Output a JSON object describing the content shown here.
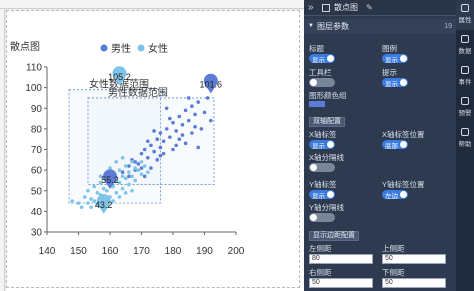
{
  "chart": {
    "title": "散点图",
    "legend": [
      {
        "name": "男性",
        "color": "#5b7bd5"
      },
      {
        "name": "女性",
        "color": "#7ec3ea"
      }
    ],
    "region_labels": [
      "女性数据范围",
      "男性数据范围"
    ],
    "markers": [
      "105.2",
      "101.6",
      "55.2",
      "43.2"
    ]
  },
  "chart_data": {
    "type": "scatter",
    "title": "散点图",
    "xlim": [
      140,
      200
    ],
    "ylim": [
      30,
      110
    ],
    "xticks": [
      140,
      150,
      160,
      170,
      180,
      190,
      200
    ],
    "yticks": [
      30,
      40,
      50,
      60,
      70,
      80,
      90,
      100,
      110
    ],
    "series": [
      {
        "name": "男性",
        "color": "#5b7bd5",
        "points": [
          [
            164,
            59
          ],
          [
            166,
            62
          ],
          [
            167,
            65
          ],
          [
            168,
            64
          ],
          [
            170,
            68
          ],
          [
            171,
            70
          ],
          [
            172,
            66
          ],
          [
            173,
            72
          ],
          [
            174,
            69
          ],
          [
            175,
            75
          ],
          [
            176,
            71
          ],
          [
            176,
            78
          ],
          [
            177,
            74
          ],
          [
            178,
            80
          ],
          [
            179,
            76
          ],
          [
            180,
            83
          ],
          [
            181,
            79
          ],
          [
            182,
            86
          ],
          [
            183,
            82
          ],
          [
            184,
            89
          ],
          [
            185,
            84
          ],
          [
            186,
            91
          ],
          [
            187,
            87
          ],
          [
            188,
            93
          ],
          [
            189,
            80
          ],
          [
            190,
            88
          ],
          [
            191,
            95
          ],
          [
            169,
            63
          ],
          [
            172,
            74
          ],
          [
            174,
            79
          ],
          [
            177,
            68
          ],
          [
            179,
            85
          ],
          [
            181,
            72
          ],
          [
            183,
            77
          ],
          [
            185,
            95
          ],
          [
            187,
            81
          ],
          [
            192,
            84
          ],
          [
            178,
            90
          ],
          [
            173,
            61
          ],
          [
            168,
            60
          ],
          [
            171,
            57
          ],
          [
            175,
            65
          ],
          [
            180,
            70
          ],
          [
            184,
            73
          ],
          [
            166,
            57
          ],
          [
            170,
            61
          ],
          [
            176,
            67
          ],
          [
            182,
            75
          ],
          [
            186,
            78
          ],
          [
            188,
            71
          ]
        ]
      },
      {
        "name": "女性",
        "color": "#7ec3ea",
        "points": [
          [
            150,
            44
          ],
          [
            152,
            47
          ],
          [
            153,
            50
          ],
          [
            154,
            46
          ],
          [
            155,
            52
          ],
          [
            156,
            49
          ],
          [
            157,
            54
          ],
          [
            158,
            51
          ],
          [
            159,
            56
          ],
          [
            160,
            53
          ],
          [
            161,
            58
          ],
          [
            162,
            55
          ],
          [
            163,
            60
          ],
          [
            164,
            57
          ],
          [
            165,
            62
          ],
          [
            166,
            59
          ],
          [
            167,
            64
          ],
          [
            168,
            61
          ],
          [
            155,
            45
          ],
          [
            157,
            48
          ],
          [
            159,
            50
          ],
          [
            161,
            52
          ],
          [
            163,
            54
          ],
          [
            165,
            56
          ],
          [
            160,
            47
          ],
          [
            162,
            49
          ],
          [
            164,
            51
          ],
          [
            158,
            45
          ],
          [
            156,
            43
          ],
          [
            154,
            42
          ],
          [
            166,
            53
          ],
          [
            168,
            55
          ],
          [
            170,
            58
          ],
          [
            170,
            64
          ],
          [
            167,
            50
          ],
          [
            163,
            47
          ],
          [
            161,
            45
          ],
          [
            159,
            43
          ],
          [
            157,
            57
          ],
          [
            160,
            61
          ],
          [
            162,
            64
          ],
          [
            164,
            66
          ],
          [
            148,
            45
          ],
          [
            151,
            42
          ],
          [
            153,
            44
          ],
          [
            169,
            60
          ],
          [
            171,
            62
          ],
          [
            172,
            59
          ],
          [
            165,
            49
          ],
          [
            167,
            57
          ]
        ]
      }
    ],
    "regions": [
      {
        "name": "女性数据范围",
        "x": [
          147,
          176
        ],
        "y": [
          44,
          99
        ]
      },
      {
        "name": "男性数据范围",
        "x": [
          153,
          193
        ],
        "y": [
          53,
          95
        ]
      }
    ],
    "pins": [
      {
        "label": "105.2",
        "x": 163,
        "y": 105.2,
        "series": "女性"
      },
      {
        "label": "101.6",
        "x": 192,
        "y": 101.6,
        "series": "男性"
      },
      {
        "label": "55.2",
        "x": 160,
        "y": 55.2,
        "series": "男性"
      },
      {
        "label": "43.2",
        "x": 158,
        "y": 43.2,
        "series": "女性"
      }
    ]
  },
  "panel": {
    "header_title": "散点图",
    "section_title": "图层参数",
    "section_count": "19",
    "rows": {
      "title_label": "标题",
      "legend_label": "图例",
      "toolbar_label": "工具栏",
      "tooltip_label": "提示",
      "colorgroup_label": "图形颜色组",
      "dual_axis_label": "双轴配置",
      "x_tick_label": "X轴标签",
      "x_tick_pos_label": "X轴标签位置",
      "x_split_label": "X轴分隔线",
      "y_tick_label": "Y轴标签",
      "y_tick_pos_label": "Y轴标签位置",
      "y_split_label": "Y轴分隔线",
      "margin_btn": "显示边距配置",
      "left_margin_label": "左侧距",
      "top_margin_label": "上侧距",
      "right_margin_label": "右侧距",
      "bottom_margin_label": "下侧距"
    },
    "toggle_on": "显示",
    "toggle_bottom": "底部",
    "toggle_left": "左边",
    "inputs": {
      "left": "80",
      "top": "50",
      "right": "50",
      "bottom": "50"
    }
  },
  "tabs": [
    "数据",
    "事件",
    "预警",
    "帮助"
  ],
  "tab_active_label": "属性"
}
